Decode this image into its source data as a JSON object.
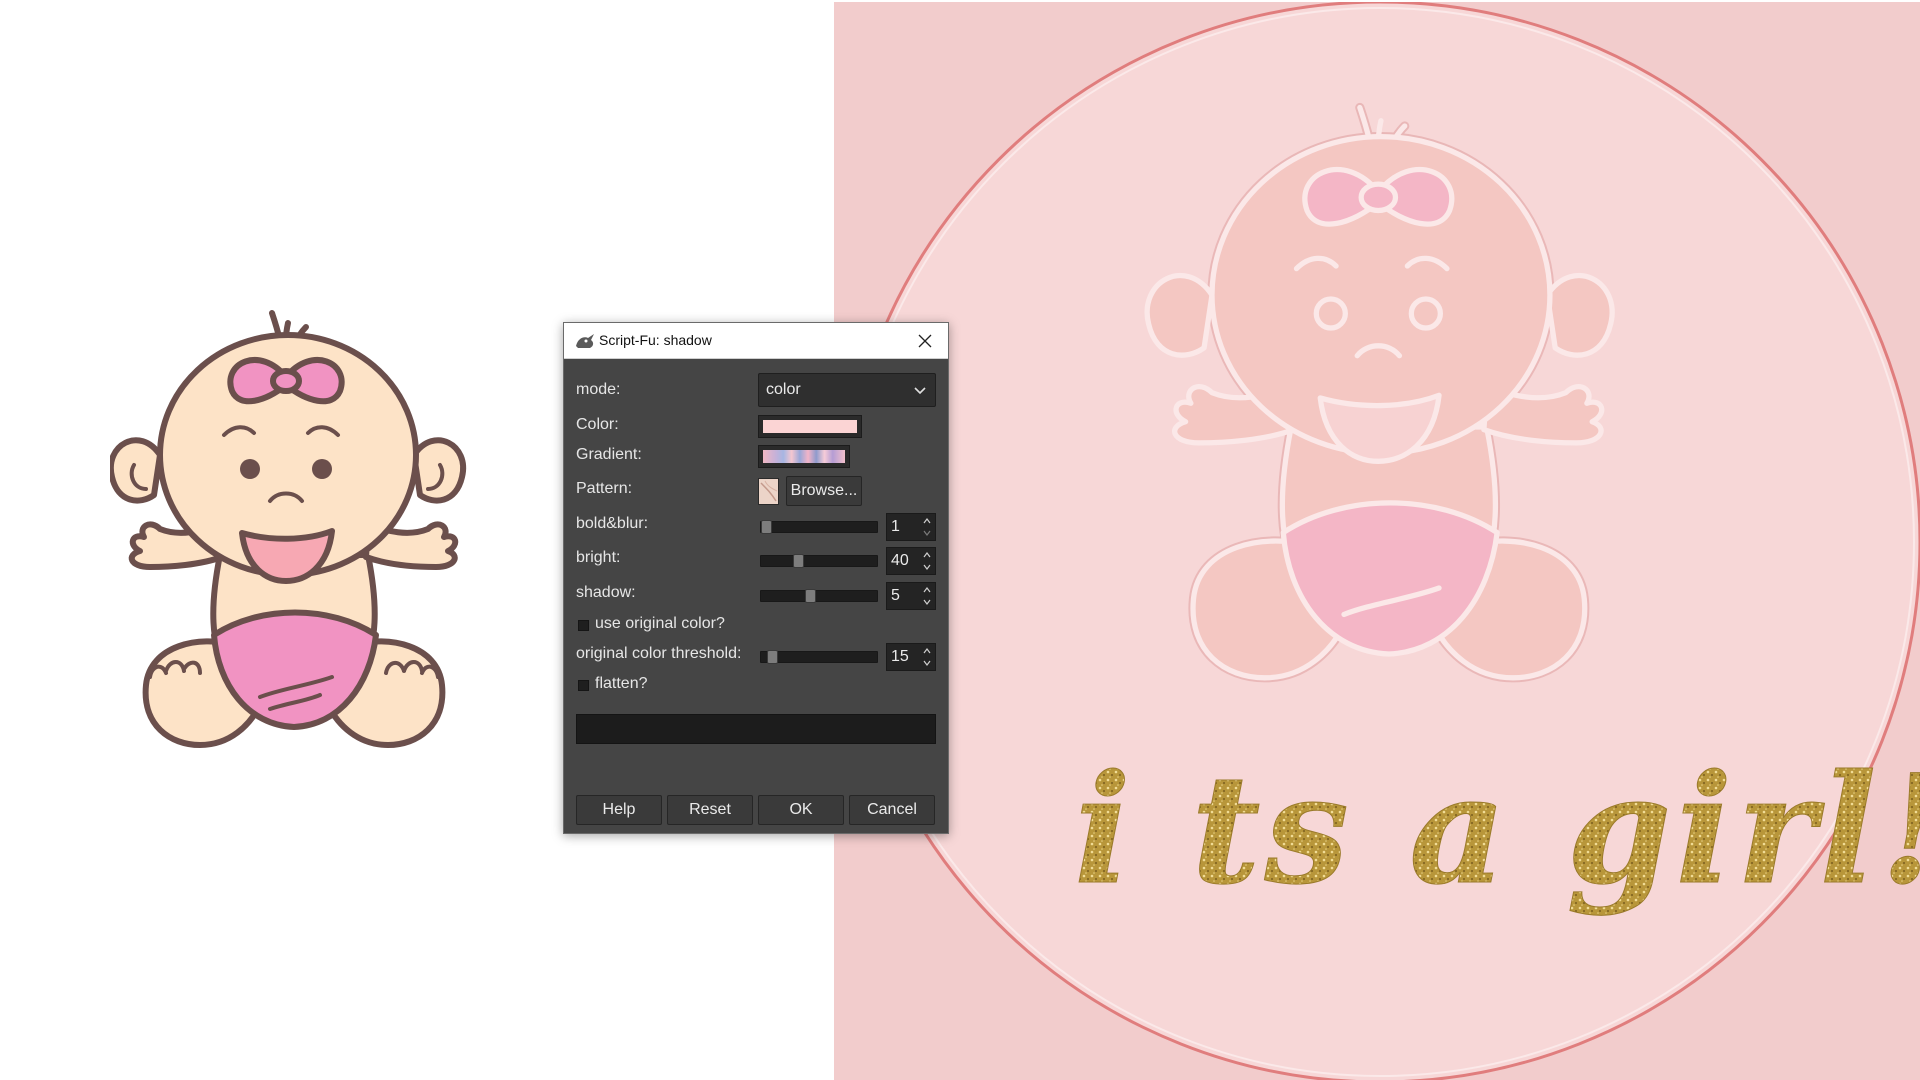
{
  "dialog": {
    "title": "Script-Fu: shadow",
    "title_icon": "wilber-icon",
    "close_icon": "close-icon",
    "fields": {
      "mode": {
        "label": "mode:",
        "value": "color"
      },
      "color": {
        "label": "Color:",
        "value": "#fbd4d4"
      },
      "gradient": {
        "label": "Gradient:"
      },
      "pattern": {
        "label": "Pattern:",
        "browse_label": "Browse..."
      },
      "bold_blur": {
        "label": "bold&blur:",
        "value": "1",
        "slider_fraction": 0.0
      },
      "bright": {
        "label": "bright:",
        "value": "40",
        "slider_fraction": 0.3
      },
      "shadow": {
        "label": "shadow:",
        "value": "5",
        "slider_fraction": 0.42
      },
      "use_original_color": {
        "label": "use original color?",
        "checked": false
      },
      "original_color_threshold": {
        "label": "original color threshold:",
        "value": "15",
        "slider_fraction": 0.06
      },
      "flatten": {
        "label": "flatten?",
        "checked": false
      }
    },
    "buttons": {
      "help": "Help",
      "reset": "Reset",
      "ok": "OK",
      "cancel": "Cancel"
    }
  },
  "canvas": {
    "text": "i ts a girl!",
    "colors": {
      "background": "#f2cccc",
      "circle_fill": "#f7d7d7",
      "circle_ring": "#e07d7d",
      "glitter_gold": "#b8963a",
      "diaper_pink": "#f193c2",
      "skin": "#fde3c7",
      "outline": "#6b4f4c"
    }
  }
}
